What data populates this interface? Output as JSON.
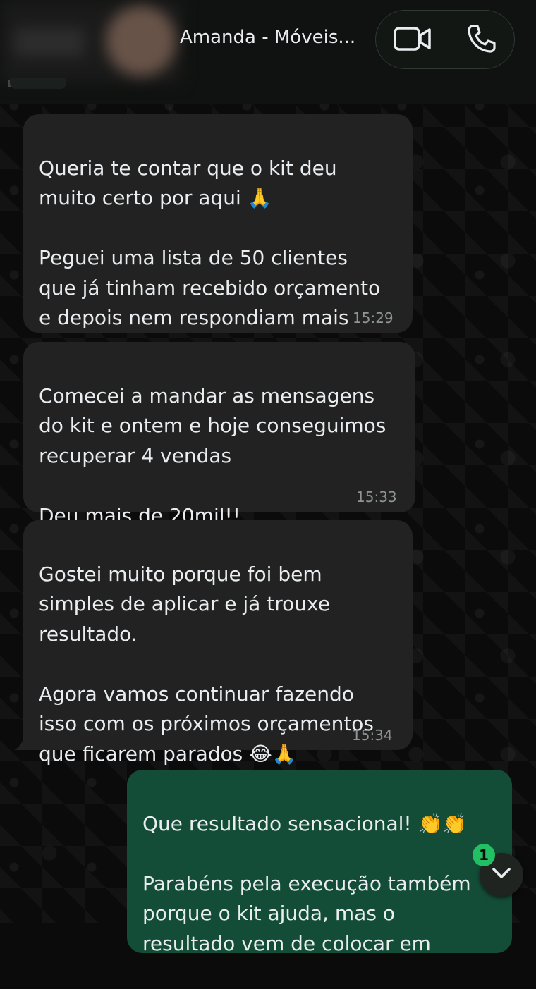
{
  "header": {
    "contact_name": "Amanda - Móveis...",
    "video_call_icon": "video-camera-icon",
    "voice_call_icon": "phone-icon"
  },
  "messages": [
    {
      "direction": "incoming",
      "text": "Queria te contar que o kit deu\nmuito certo por aqui 🙏\n\nPeguei uma lista de 50 clientes\nque já tinham recebido orçamento\ne depois nem respondiam mais",
      "time": "15:29"
    },
    {
      "direction": "incoming",
      "text": "Comecei a mandar as mensagens\ndo kit e ontem e hoje conseguimos\nrecuperar 4 vendas\n\nDeu mais de 20mil!!",
      "time": "15:33"
    },
    {
      "direction": "incoming",
      "text": "Gostei muito porque foi bem\nsimples de aplicar e já trouxe\nresultado.\n\nAgora vamos continuar fazendo\nisso com os próximos orçamentos\nque ficarem parados 😂🙏",
      "time": "15:34"
    },
    {
      "direction": "outgoing",
      "text": "Que resultado sensacional! 👏👏\n\nParabéns pela execução também\nporque o kit ajuda, mas o\nresultado vem de colocar em",
      "time": ""
    }
  ],
  "scroll": {
    "unread_count": "1",
    "icon": "chevron-down-icon"
  },
  "colors": {
    "incoming_bubble": "#222222",
    "outgoing_bubble": "#144d37",
    "badge": "#21c063"
  }
}
